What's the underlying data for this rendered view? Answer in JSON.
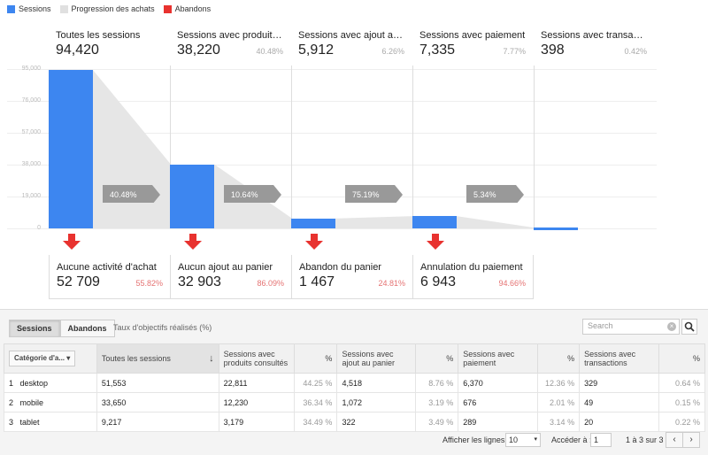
{
  "legend": [
    {
      "label": "Sessions",
      "color": "#3d86f0"
    },
    {
      "label": "Progression des achats",
      "color": "#e0e0e0"
    },
    {
      "label": "Abandons",
      "color": "#e8322f"
    }
  ],
  "chart_data": {
    "type": "bar",
    "y_ticks": [
      "95,000",
      "76,000",
      "57,000",
      "38,000",
      "19,000",
      "0"
    ],
    "ylim": [
      0,
      95000
    ],
    "stages": [
      {
        "title": "Toutes les sessions",
        "value": 94420,
        "value_label": "94,420",
        "pct": ""
      },
      {
        "title": "Sessions avec produits co...",
        "value": 38220,
        "value_label": "38,220",
        "pct": "40.48%"
      },
      {
        "title": "Sessions avec ajout au pa...",
        "value": 5912,
        "value_label": "5,912",
        "pct": "6.26%"
      },
      {
        "title": "Sessions avec paiement",
        "value": 7335,
        "value_label": "7,335",
        "pct": "7.77%"
      },
      {
        "title": "Sessions avec transactions",
        "value": 398,
        "value_label": "398",
        "pct": "0.42%"
      }
    ],
    "conversions": [
      "40.48%",
      "10.64%",
      "75.19%",
      "5.34%"
    ],
    "dropoffs": [
      {
        "title": "Aucune activité d'achat",
        "value": "52 709",
        "pct": "55.82%"
      },
      {
        "title": "Aucun ajout au panier",
        "value": "32 903",
        "pct": "86.09%"
      },
      {
        "title": "Abandon du panier",
        "value": "1 467",
        "pct": "24.81%"
      },
      {
        "title": "Annulation du paiement",
        "value": "6 943",
        "pct": "94.66%"
      }
    ]
  },
  "table": {
    "tabs": [
      "Sessions",
      "Abandons"
    ],
    "goal_rate_label": "Taux d'objectifs réalisés (%)",
    "search_placeholder": "Search",
    "category_select": "Catégorie d'a...",
    "headers": [
      "Toutes les sessions",
      "Sessions avec produits consultés",
      "%",
      "Sessions avec ajout au panier",
      "%",
      "Sessions avec paiement",
      "%",
      "Sessions avec transactions",
      "%"
    ],
    "rows": [
      [
        "1",
        "desktop",
        "51,553",
        "22,811",
        "44.25 %",
        "4,518",
        "8.76 %",
        "6,370",
        "12.36 %",
        "329",
        "0.64 %"
      ],
      [
        "2",
        "mobile",
        "33,650",
        "12,230",
        "36.34 %",
        "1,072",
        "3.19 %",
        "676",
        "2.01 %",
        "49",
        "0.15 %"
      ],
      [
        "3",
        "tablet",
        "9,217",
        "3,179",
        "34.49 %",
        "322",
        "3.49 %",
        "289",
        "3.14 %",
        "20",
        "0.22 %"
      ]
    ],
    "footer": {
      "rows_label": "Afficher les lignes :",
      "rows_value": "10",
      "goto_label": "Accéder à :",
      "goto_value": "1",
      "range": "1 à 3 sur 3"
    }
  }
}
